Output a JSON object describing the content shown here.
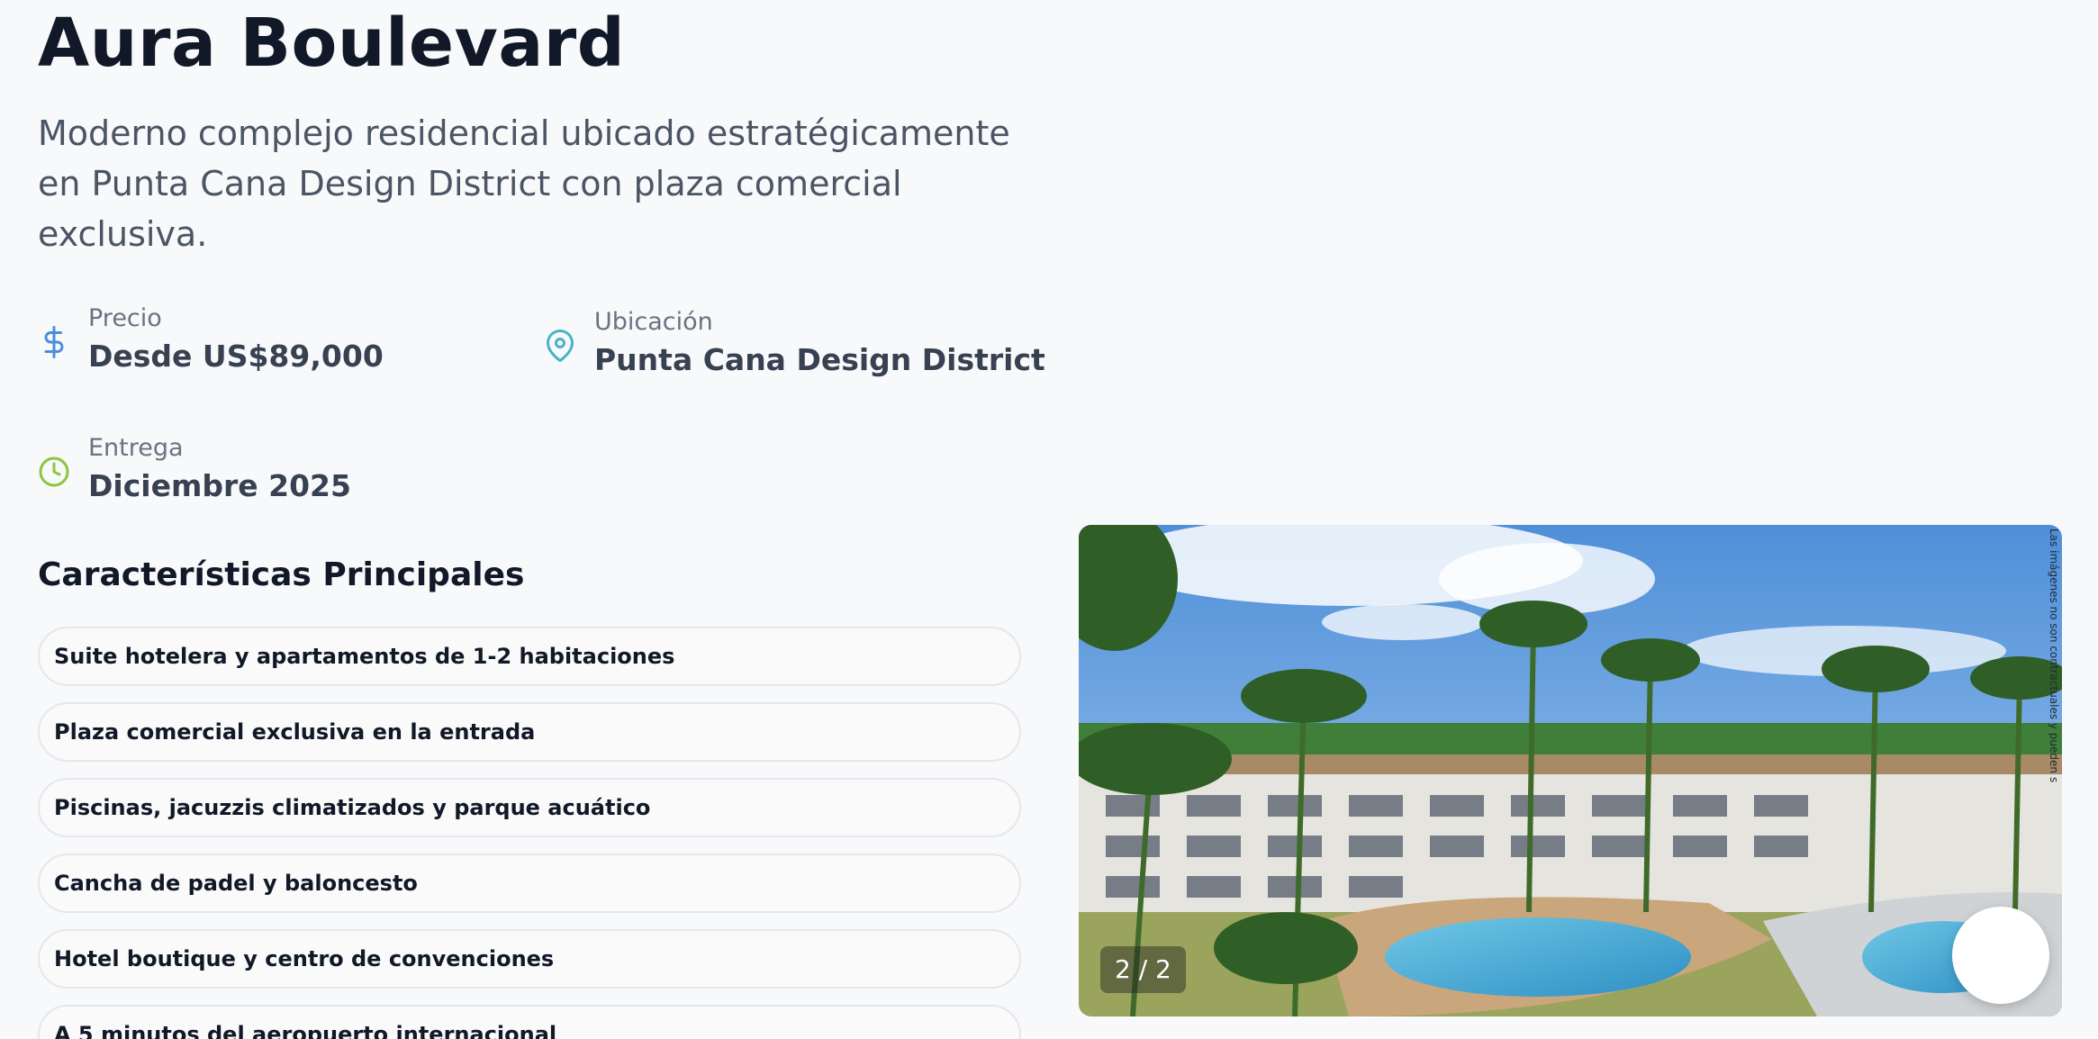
{
  "project": {
    "title": "Aura Boulevard",
    "description": "Moderno complejo residencial ubicado estratégicamente en Punta Cana Design District con plaza comercial exclusiva."
  },
  "stats": {
    "price": {
      "label": "Precio",
      "value": "Desde US$89,000",
      "icon": "dollar-icon",
      "color": "#4a90d9"
    },
    "location": {
      "label": "Ubicación",
      "value": "Punta Cana Design District",
      "icon": "map-pin-icon",
      "color": "#4ab3c8"
    },
    "delivery": {
      "label": "Entrega",
      "value": "Diciembre 2025",
      "icon": "clock-icon",
      "color": "#8cc63f"
    }
  },
  "features": {
    "title": "Características Principales",
    "items": [
      "Suite hotelera y apartamentos de 1-2 habitaciones",
      "Plaza comercial exclusiva en la entrada",
      "Piscinas, jacuzzis climatizados y parque acuático",
      "Cancha de padel y baloncesto",
      "Hotel boutique y centro de convenciones",
      "A 5 minutos del aeropuerto internacional"
    ]
  },
  "gallery": {
    "counter": "2 / 2",
    "disclaimer": "Las imágenes no son contractuales y pueden s"
  }
}
